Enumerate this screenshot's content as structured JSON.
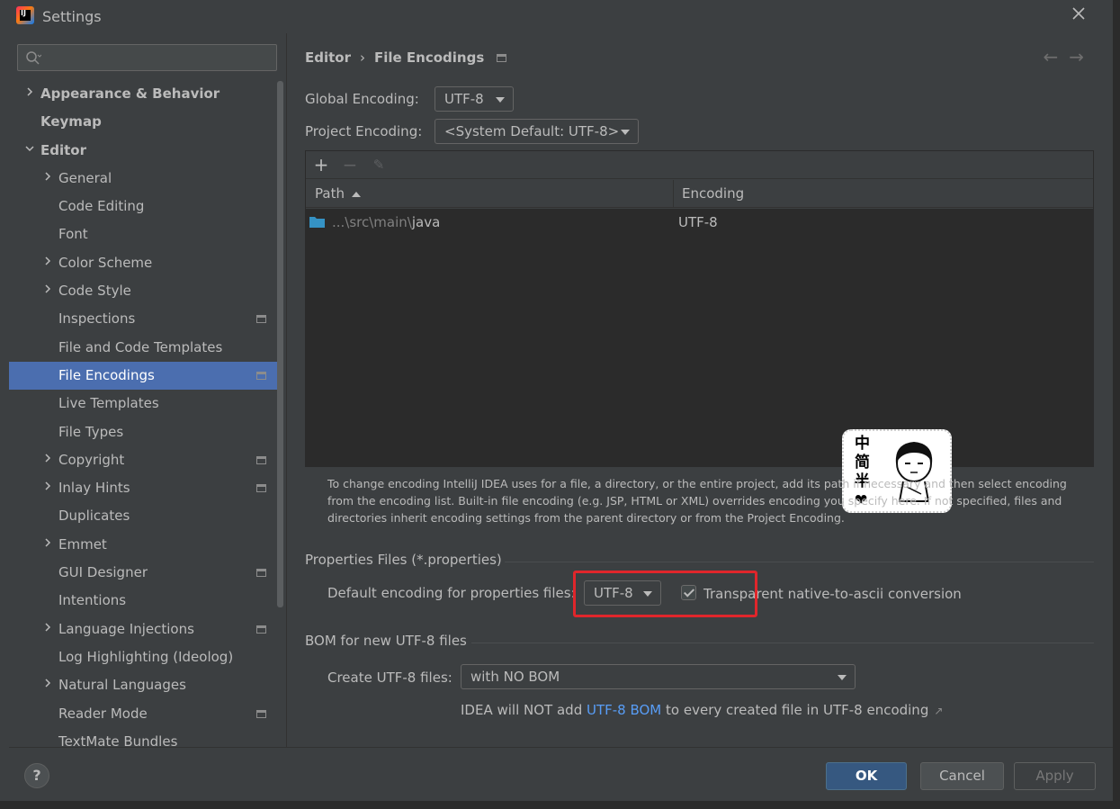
{
  "window": {
    "title": "Settings"
  },
  "sidebar": {
    "search_placeholder": "",
    "items": [
      {
        "label": "Appearance & Behavior",
        "level": 0,
        "arrow": "collapsed",
        "bold": true,
        "project_icon": false
      },
      {
        "label": "Keymap",
        "level": 0,
        "arrow": "none",
        "bold": true,
        "project_icon": false
      },
      {
        "label": "Editor",
        "level": 0,
        "arrow": "expanded",
        "bold": true,
        "project_icon": false
      },
      {
        "label": "General",
        "level": 1,
        "arrow": "collapsed",
        "bold": false,
        "project_icon": false
      },
      {
        "label": "Code Editing",
        "level": 1,
        "arrow": "none",
        "bold": false,
        "project_icon": false
      },
      {
        "label": "Font",
        "level": 1,
        "arrow": "none",
        "bold": false,
        "project_icon": false
      },
      {
        "label": "Color Scheme",
        "level": 1,
        "arrow": "collapsed",
        "bold": false,
        "project_icon": false
      },
      {
        "label": "Code Style",
        "level": 1,
        "arrow": "collapsed",
        "bold": false,
        "project_icon": false
      },
      {
        "label": "Inspections",
        "level": 1,
        "arrow": "none",
        "bold": false,
        "project_icon": true
      },
      {
        "label": "File and Code Templates",
        "level": 1,
        "arrow": "none",
        "bold": false,
        "project_icon": false
      },
      {
        "label": "File Encodings",
        "level": 1,
        "arrow": "none",
        "bold": false,
        "project_icon": true,
        "selected": true
      },
      {
        "label": "Live Templates",
        "level": 1,
        "arrow": "none",
        "bold": false,
        "project_icon": false
      },
      {
        "label": "File Types",
        "level": 1,
        "arrow": "none",
        "bold": false,
        "project_icon": false
      },
      {
        "label": "Copyright",
        "level": 1,
        "arrow": "collapsed",
        "bold": false,
        "project_icon": true
      },
      {
        "label": "Inlay Hints",
        "level": 1,
        "arrow": "collapsed",
        "bold": false,
        "project_icon": true
      },
      {
        "label": "Duplicates",
        "level": 1,
        "arrow": "none",
        "bold": false,
        "project_icon": false
      },
      {
        "label": "Emmet",
        "level": 1,
        "arrow": "collapsed",
        "bold": false,
        "project_icon": false
      },
      {
        "label": "GUI Designer",
        "level": 1,
        "arrow": "none",
        "bold": false,
        "project_icon": true
      },
      {
        "label": "Intentions",
        "level": 1,
        "arrow": "none",
        "bold": false,
        "project_icon": false
      },
      {
        "label": "Language Injections",
        "level": 1,
        "arrow": "collapsed",
        "bold": false,
        "project_icon": true
      },
      {
        "label": "Log Highlighting (Ideolog)",
        "level": 1,
        "arrow": "none",
        "bold": false,
        "project_icon": false
      },
      {
        "label": "Natural Languages",
        "level": 1,
        "arrow": "collapsed",
        "bold": false,
        "project_icon": false
      },
      {
        "label": "Reader Mode",
        "level": 1,
        "arrow": "none",
        "bold": false,
        "project_icon": true
      },
      {
        "label": "TextMate Bundles",
        "level": 1,
        "arrow": "none",
        "bold": false,
        "project_icon": false
      }
    ]
  },
  "breadcrumb": {
    "parent": "Editor",
    "separator": "›",
    "current": "File Encodings"
  },
  "nav": {
    "back": "←",
    "forward": "→"
  },
  "global_encoding": {
    "label": "Global Encoding:",
    "value": "UTF-8"
  },
  "project_encoding": {
    "label": "Project Encoding:",
    "value": "<System Default: UTF-8>"
  },
  "table": {
    "toolbar": {
      "add": "+",
      "remove": "−",
      "edit": "✎"
    },
    "columns": {
      "path": "Path",
      "encoding": "Encoding"
    },
    "rows": [
      {
        "path_dim": "...\\src\\main\\",
        "path_main": "java",
        "encoding": "UTF-8"
      }
    ]
  },
  "sticker": {
    "chars": [
      "中",
      "简",
      "半",
      "❤"
    ]
  },
  "help_text": "To change encoding IntelliJ IDEA uses for a file, a directory, or the entire project, add its path if necessary and then select encoding from the encoding list. Built-in file encoding (e.g. JSP, HTML or XML) overrides encoding you specify here. If not specified, files and directories inherit encoding settings from the parent directory or from the Project Encoding.",
  "properties": {
    "section_title": "Properties Files (*.properties)",
    "label": "Default encoding for properties files:",
    "value": "UTF-8",
    "checkbox_label": "Transparent native-to-ascii conversion",
    "checked": true
  },
  "bom": {
    "section_title": "BOM for new UTF-8 files",
    "label": "Create UTF-8 files:",
    "value": "with NO BOM",
    "note_prefix": "IDEA will NOT add ",
    "note_link": "UTF-8 BOM",
    "note_suffix": " to every created file in UTF-8 encoding",
    "note_arrow": "↗"
  },
  "footer": {
    "help": "?",
    "ok": "OK",
    "cancel": "Cancel",
    "apply": "Apply"
  },
  "colors": {
    "selection": "#4b6eaf",
    "link": "#589df6",
    "highlight": "#e0262b",
    "ok_button": "#365880"
  }
}
